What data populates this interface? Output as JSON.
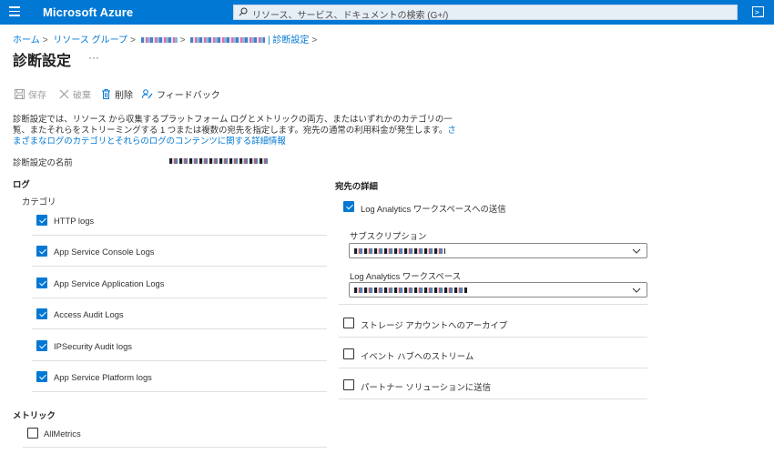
{
  "topbar": {
    "brand": "Microsoft Azure",
    "search_placeholder": "リソース、サービス、ドキュメントの検索 (G+/)",
    "accent": "#0078d4"
  },
  "breadcrumb": {
    "home": "ホーム",
    "resource_groups": "リソース グループ",
    "current_suffix": "| 診断設定"
  },
  "page": {
    "title": "診断設定",
    "more": "···"
  },
  "toolbar": {
    "save": "保存",
    "discard": "破棄",
    "delete": "削除",
    "feedback": "フィードバック"
  },
  "description": {
    "text": "診断設定では、リソース から収集するプラットフォーム ログとメトリックの両方、またはいずれかのカテゴリの一覧、またそれらをストリーミングする 1 つまたは複数の宛先を指定します。宛先の通常の利用料金が発生します。",
    "link": "さまざまなログのカテゴリとそれらのログのコンテンツに関する詳細情報"
  },
  "setting_name": {
    "label": "診断設定の名前"
  },
  "logs": {
    "heading": "ログ",
    "category_label": "カテゴリ",
    "items": [
      {
        "label": "HTTP logs",
        "checked": true
      },
      {
        "label": "App Service Console Logs",
        "checked": true
      },
      {
        "label": "App Service Application Logs",
        "checked": true
      },
      {
        "label": "Access Audit Logs",
        "checked": true
      },
      {
        "label": "IPSecurity Audit logs",
        "checked": true
      },
      {
        "label": "App Service Platform logs",
        "checked": true
      }
    ]
  },
  "metrics": {
    "heading": "メトリック",
    "items": [
      {
        "label": "AllMetrics",
        "checked": false
      }
    ]
  },
  "destination": {
    "heading": "宛先の詳細",
    "log_analytics": {
      "label": "Log Analytics ワークスペースへの送信",
      "checked": true
    },
    "subscription_label": "サブスクリプション",
    "workspace_label": "Log Analytics ワークスペース",
    "storage": {
      "label": "ストレージ アカウントへのアーカイブ",
      "checked": false
    },
    "event_hub": {
      "label": "イベント ハブへのストリーム",
      "checked": false
    },
    "partner": {
      "label": "パートナー ソリューションに送信",
      "checked": false
    }
  }
}
